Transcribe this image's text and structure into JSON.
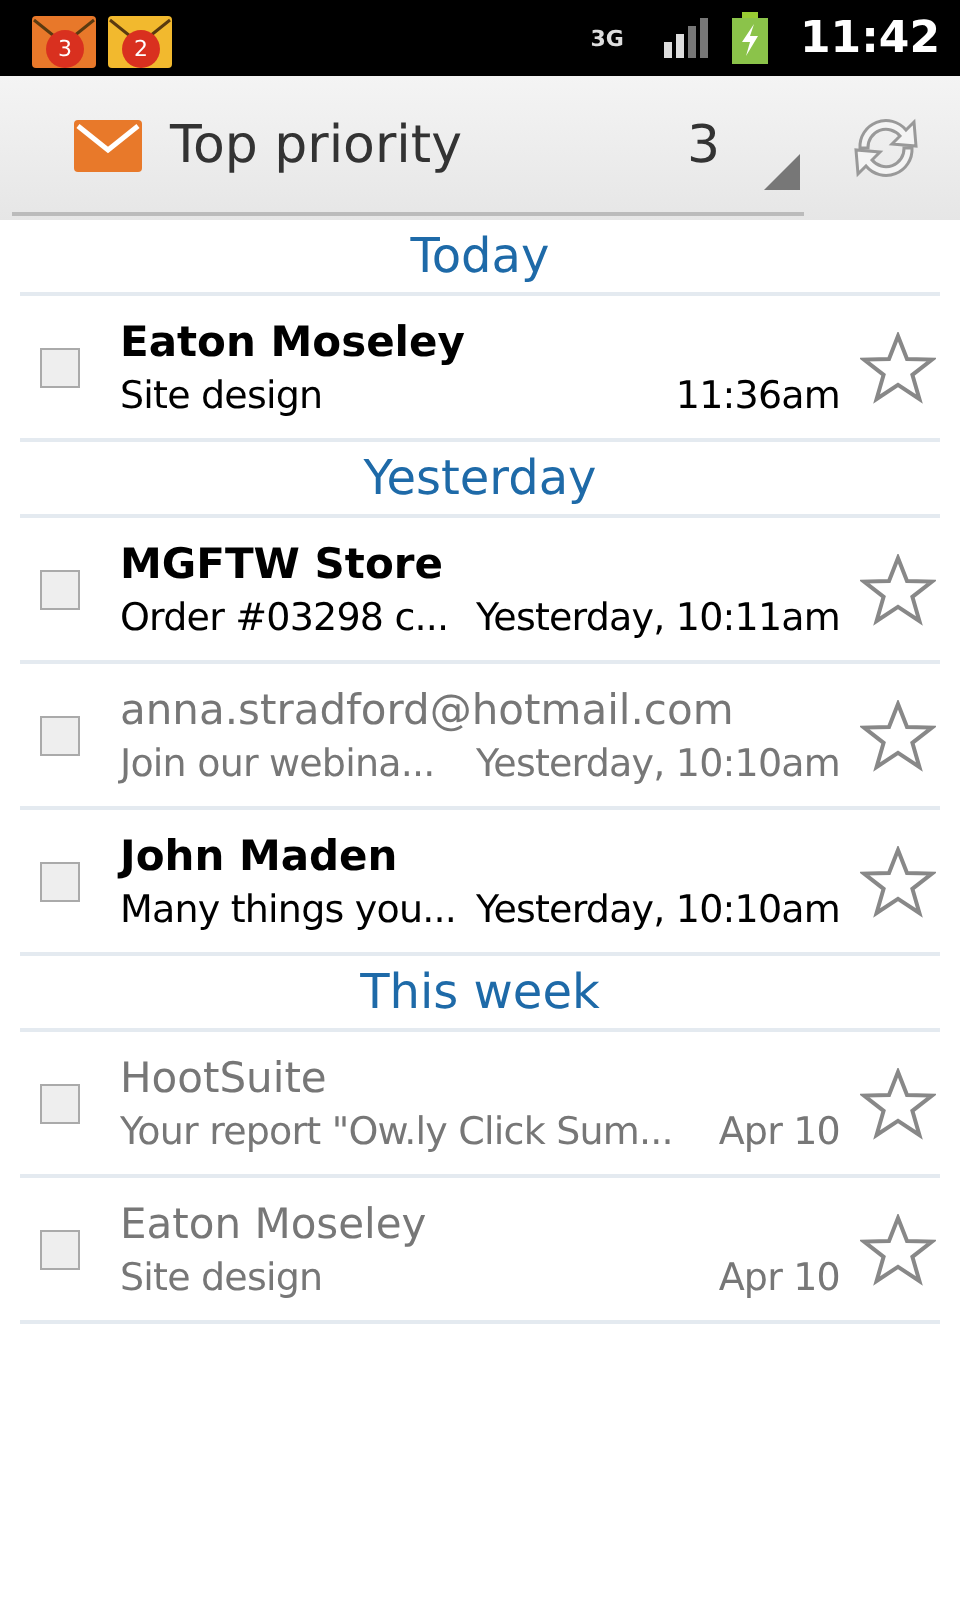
{
  "status_bar": {
    "notifications": [
      {
        "count": "3",
        "color": "#e8782a"
      },
      {
        "count": "2",
        "color": "#f2b92e"
      }
    ],
    "network": "3G",
    "time": "11:42"
  },
  "header": {
    "label": "Top priority",
    "count": "3"
  },
  "groups": [
    {
      "title": "Today",
      "messages": [
        {
          "sender": "Eaton Moseley",
          "subject": "Site design",
          "time": "11:36am",
          "unread": true,
          "checked": false,
          "starred": false
        }
      ]
    },
    {
      "title": "Yesterday",
      "messages": [
        {
          "sender": "MGFTW Store",
          "subject": "Order #03298 c...",
          "time": "Yesterday, 10:11am",
          "unread": true,
          "checked": false,
          "starred": false
        },
        {
          "sender": "anna.stradford@hotmail.com",
          "subject": "Join our webina...",
          "time": "Yesterday, 10:10am",
          "unread": false,
          "checked": false,
          "starred": false
        },
        {
          "sender": "John Maden",
          "subject": "Many things you...",
          "time": "Yesterday, 10:10am",
          "unread": true,
          "checked": false,
          "starred": false
        }
      ]
    },
    {
      "title": "This week",
      "messages": [
        {
          "sender": "HootSuite",
          "subject": "Your report \"Ow.ly Click Sum...",
          "time": "Apr 10",
          "unread": false,
          "checked": false,
          "starred": false
        },
        {
          "sender": "Eaton Moseley",
          "subject": "Site design",
          "time": "Apr 10",
          "unread": false,
          "checked": false,
          "starred": false
        }
      ]
    }
  ]
}
